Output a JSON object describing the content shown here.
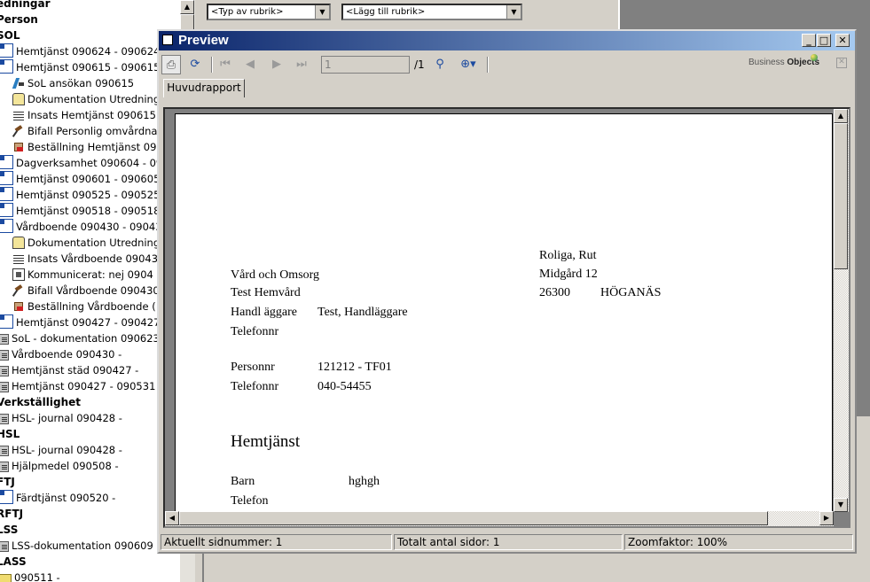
{
  "tree": {
    "items": [
      {
        "label": "edningar",
        "kind": "grp",
        "icon": "none"
      },
      {
        "label": "Person",
        "kind": "grp",
        "icon": "none"
      },
      {
        "label": "SOL",
        "kind": "grp",
        "icon": "none"
      },
      {
        "label": "Hemtjänst 090624 - 090624",
        "kind": "item",
        "icon": "plan-icon"
      },
      {
        "label": "Hemtjänst 090615 - 090615",
        "kind": "item",
        "icon": "plan-icon"
      },
      {
        "label": "SoL ansökan 090615",
        "kind": "sub",
        "icon": "application-icon"
      },
      {
        "label": "Dokumentation Utredning",
        "kind": "sub",
        "icon": "documentation-icon"
      },
      {
        "label": "Insats Hemtjänst 090615",
        "kind": "sub",
        "icon": "list-icon"
      },
      {
        "label": "Bifall Personlig omvårdna",
        "kind": "sub",
        "icon": "gavel-icon"
      },
      {
        "label": "Beställning Hemtjänst 09",
        "kind": "sub",
        "icon": "order-icon"
      },
      {
        "label": "Dagverksamhet 090604 - 09",
        "kind": "item",
        "icon": "plan-icon"
      },
      {
        "label": "Hemtjänst 090601 - 090605",
        "kind": "item",
        "icon": "plan-icon"
      },
      {
        "label": "Hemtjänst 090525 - 090525",
        "kind": "item",
        "icon": "plan-icon"
      },
      {
        "label": "Hemtjänst 090518 - 090518",
        "kind": "item",
        "icon": "plan-icon"
      },
      {
        "label": "Vårdboende 090430 - 09043",
        "kind": "item",
        "icon": "plan-icon"
      },
      {
        "label": "Dokumentation Utredning",
        "kind": "sub",
        "icon": "documentation-icon"
      },
      {
        "label": "Insats Vårdboende 09043",
        "kind": "sub",
        "icon": "list-icon"
      },
      {
        "label": "Kommunicerat: nej 0904",
        "kind": "sub",
        "icon": "communicated-icon"
      },
      {
        "label": "Bifall Vårdboende 090430",
        "kind": "sub",
        "icon": "gavel-icon"
      },
      {
        "label": "Beställning Vårdboende (",
        "kind": "sub",
        "icon": "order-icon"
      },
      {
        "label": "Hemtjänst 090427 - 090427",
        "kind": "item",
        "icon": "plan-icon"
      },
      {
        "label": "SoL - dokumentation 090623",
        "kind": "item",
        "icon": "doc-icon"
      },
      {
        "label": "Vårdboende 090430 -",
        "kind": "item",
        "icon": "doc-icon"
      },
      {
        "label": "Hemtjänst städ 090427 -",
        "kind": "item",
        "icon": "doc-icon"
      },
      {
        "label": "Hemtjänst 090427 - 090531",
        "kind": "item",
        "icon": "doc-icon"
      },
      {
        "label": "Verkställighet",
        "kind": "grp",
        "icon": "none"
      },
      {
        "label": "HSL- journal 090428 -",
        "kind": "item",
        "icon": "doc-icon"
      },
      {
        "label": "HSL",
        "kind": "grp",
        "icon": "none"
      },
      {
        "label": "HSL- journal 090428 -",
        "kind": "item",
        "icon": "doc-icon"
      },
      {
        "label": "Hjälpmedel 090508 -",
        "kind": "item",
        "icon": "doc-icon"
      },
      {
        "label": "FTJ",
        "kind": "grp",
        "icon": "none"
      },
      {
        "label": "Färdtjänst 090520 -",
        "kind": "item",
        "icon": "plan-icon"
      },
      {
        "label": "RFTJ",
        "kind": "grp",
        "icon": "none"
      },
      {
        "label": "LSS",
        "kind": "grp",
        "icon": "none"
      },
      {
        "label": "LSS-dokumentation 090609",
        "kind": "item",
        "icon": "doc-icon"
      },
      {
        "label": "LASS",
        "kind": "grp",
        "icon": "none"
      },
      {
        "label": "090511 -",
        "kind": "item",
        "icon": "folder-icon"
      }
    ]
  },
  "background": {
    "combo_type": "<Typ av rubrik>",
    "combo_add": "<Lägg till rubrik>"
  },
  "preview": {
    "title": "Preview",
    "page_current": "1",
    "page_total": "/1",
    "brand": {
      "prefix": "Business ",
      "bold": "Objects"
    },
    "tab_label": "Huvudrapport",
    "status": {
      "current": "Aktuellt sidnummer: 1",
      "total": "Totalt antal sidor: 1",
      "zoom": "Zoomfaktor: 100%"
    }
  },
  "report": {
    "recipient": {
      "name": "Roliga, Rut",
      "street": "Midgård 12",
      "zip": "26300",
      "city": "HÖGANÄS"
    },
    "org": "Vård och Omsorg",
    "unit": "Test Hemvård",
    "handler_label": "Handl äggare",
    "handler_value": "Test, Handläggare",
    "phone_label": "Telefonnr",
    "personnr_label": "Personnr",
    "personnr_value": "121212 - TF01",
    "phone2_label": "Telefonnr",
    "phone2_value": "040-54455",
    "heading": "Hemtjänst",
    "barn_label": "Barn",
    "barn_value": "hghgh",
    "telefon_label": "Telefon"
  },
  "colors": {
    "titlebar_start": "#0a246a",
    "titlebar_end": "#a6caf0",
    "chrome": "#d4d0c8"
  }
}
